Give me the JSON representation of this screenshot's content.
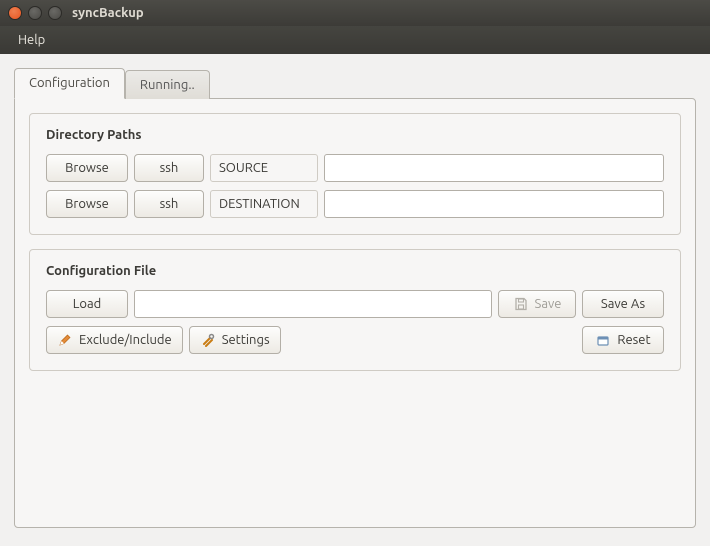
{
  "window": {
    "title": "syncBackup"
  },
  "menubar": {
    "help": "Help"
  },
  "tabs": {
    "configuration": "Configuration",
    "running": "Running.."
  },
  "groups": {
    "paths": {
      "title": "Directory Paths",
      "browse": "Browse",
      "ssh": "ssh",
      "source_label": "SOURCE",
      "destination_label": "DESTINATION",
      "source_value": "",
      "destination_value": ""
    },
    "config": {
      "title": "Configuration File",
      "load": "Load",
      "file_value": "",
      "save": "Save",
      "save_as": "Save As",
      "exclude_include": "Exclude/Include",
      "settings": "Settings",
      "reset": "Reset"
    }
  }
}
